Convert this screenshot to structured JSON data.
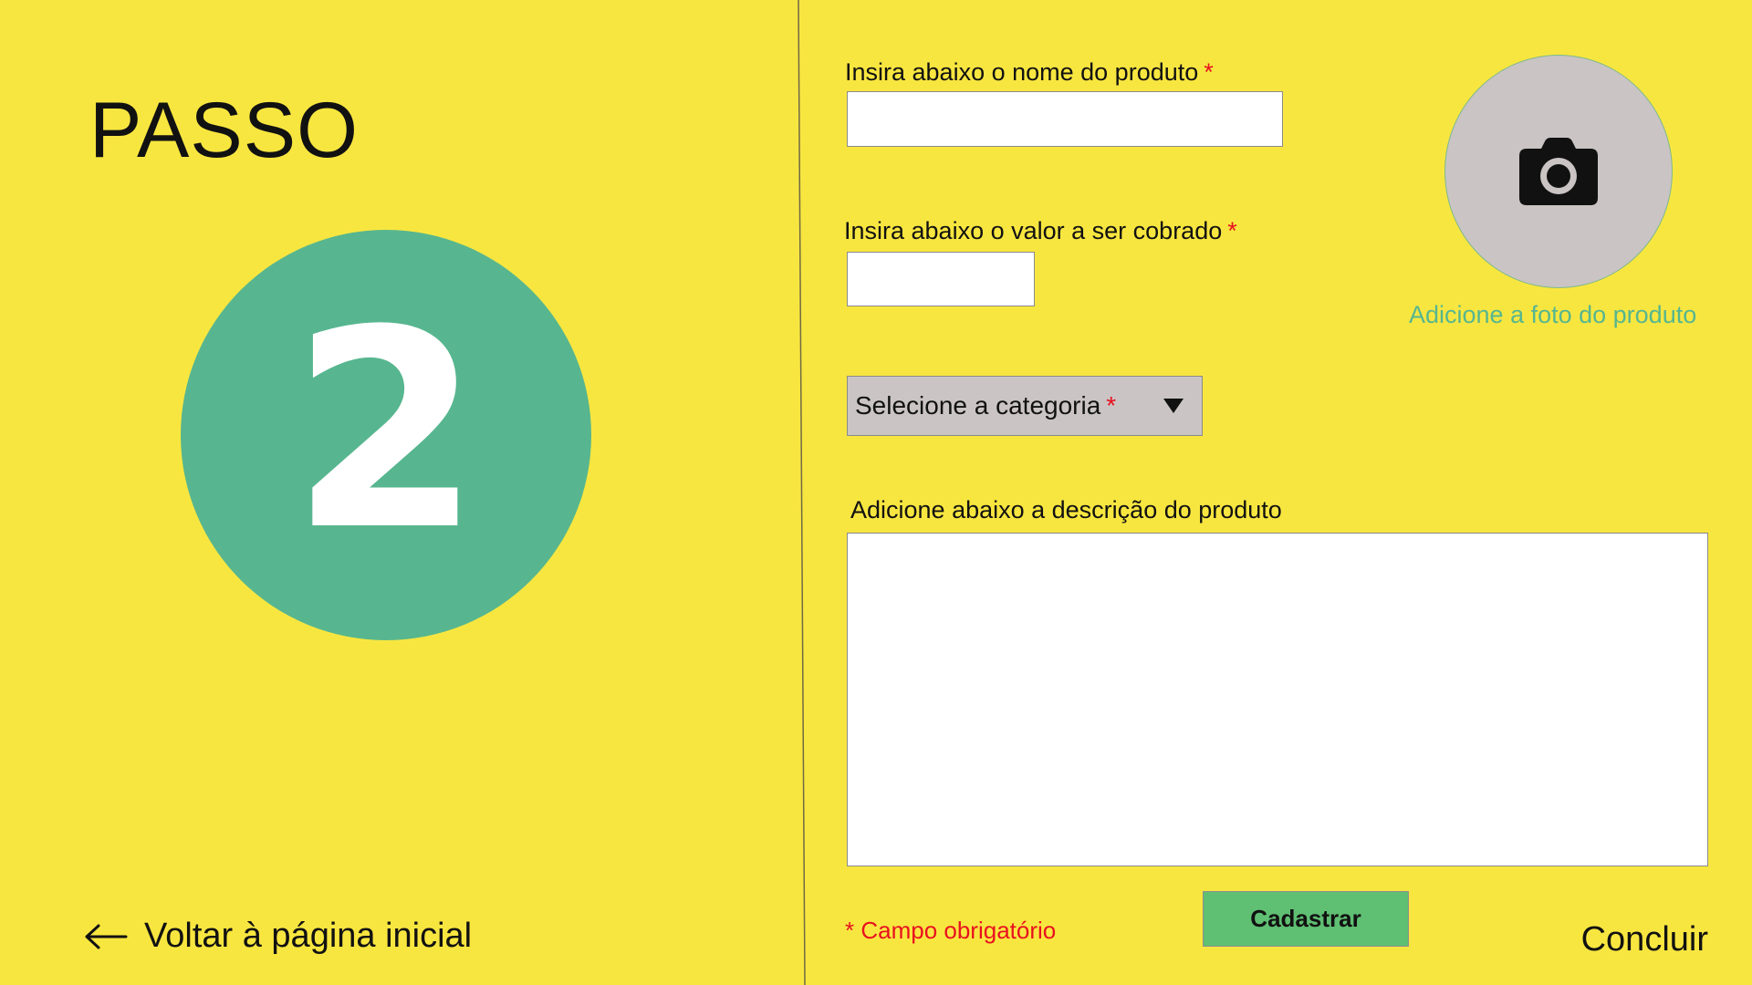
{
  "left": {
    "step_title": "PASSO",
    "step_number": "2",
    "back_label": "Voltar à página inicial"
  },
  "form": {
    "name_label": "Insira abaixo o nome do produto",
    "name_value": "",
    "price_label": "Insira abaixo o valor a ser cobrado",
    "price_value": "",
    "category_label": "Selecione a categoria",
    "description_label": "Adicione abaixo a descrição do produto",
    "description_value": "",
    "required_mark": "*",
    "required_note": "* Campo obrigatório",
    "submit_label": "Cadastrar",
    "finish_label": "Concluir"
  },
  "photo": {
    "icon": "camera-icon",
    "label": "Adicione a foto do produto"
  },
  "colors": {
    "background": "#f8e640",
    "accent_green": "#57b68f",
    "button_green": "#5fbf72",
    "required_red": "#e8111f",
    "neutral_gray": "#cac4c4"
  }
}
